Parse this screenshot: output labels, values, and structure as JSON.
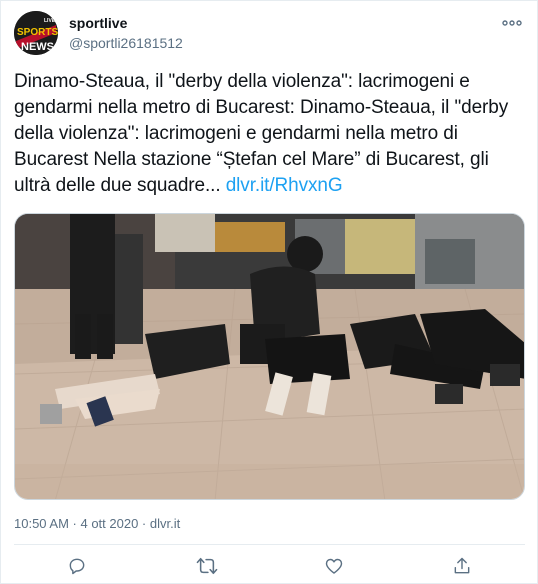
{
  "author": {
    "name": "sportlive",
    "handle": "@sportli26181512",
    "avatar_text_top": "LIVE",
    "avatar_text_main": "SPORTS",
    "avatar_text_bottom": "NEWS"
  },
  "tweet": {
    "text": "Dinamo-Steaua, il \"derby della violenza\": lacrimogeni e gendarmi nella metro di Bucarest: Dinamo-Steaua, il \"derby della violenza\": lacrimogeni e gendarmi nella metro di Bucarest Nella stazione “Ștefan cel Mare” di Bucarest, gli ultrà delle due squadre... ",
    "link": "dlvr.it/RhvxnG",
    "timestamp": "10:50 AM · 4 ott 2020 · dlvr.it"
  },
  "actions": [
    {
      "name": "reply-icon"
    },
    {
      "name": "retweet-icon"
    },
    {
      "name": "like-icon"
    },
    {
      "name": "share-icon"
    }
  ],
  "colors": {
    "link": "#1da1f2",
    "secondary_text": "#5b7083",
    "border": "#e6ecf0"
  }
}
